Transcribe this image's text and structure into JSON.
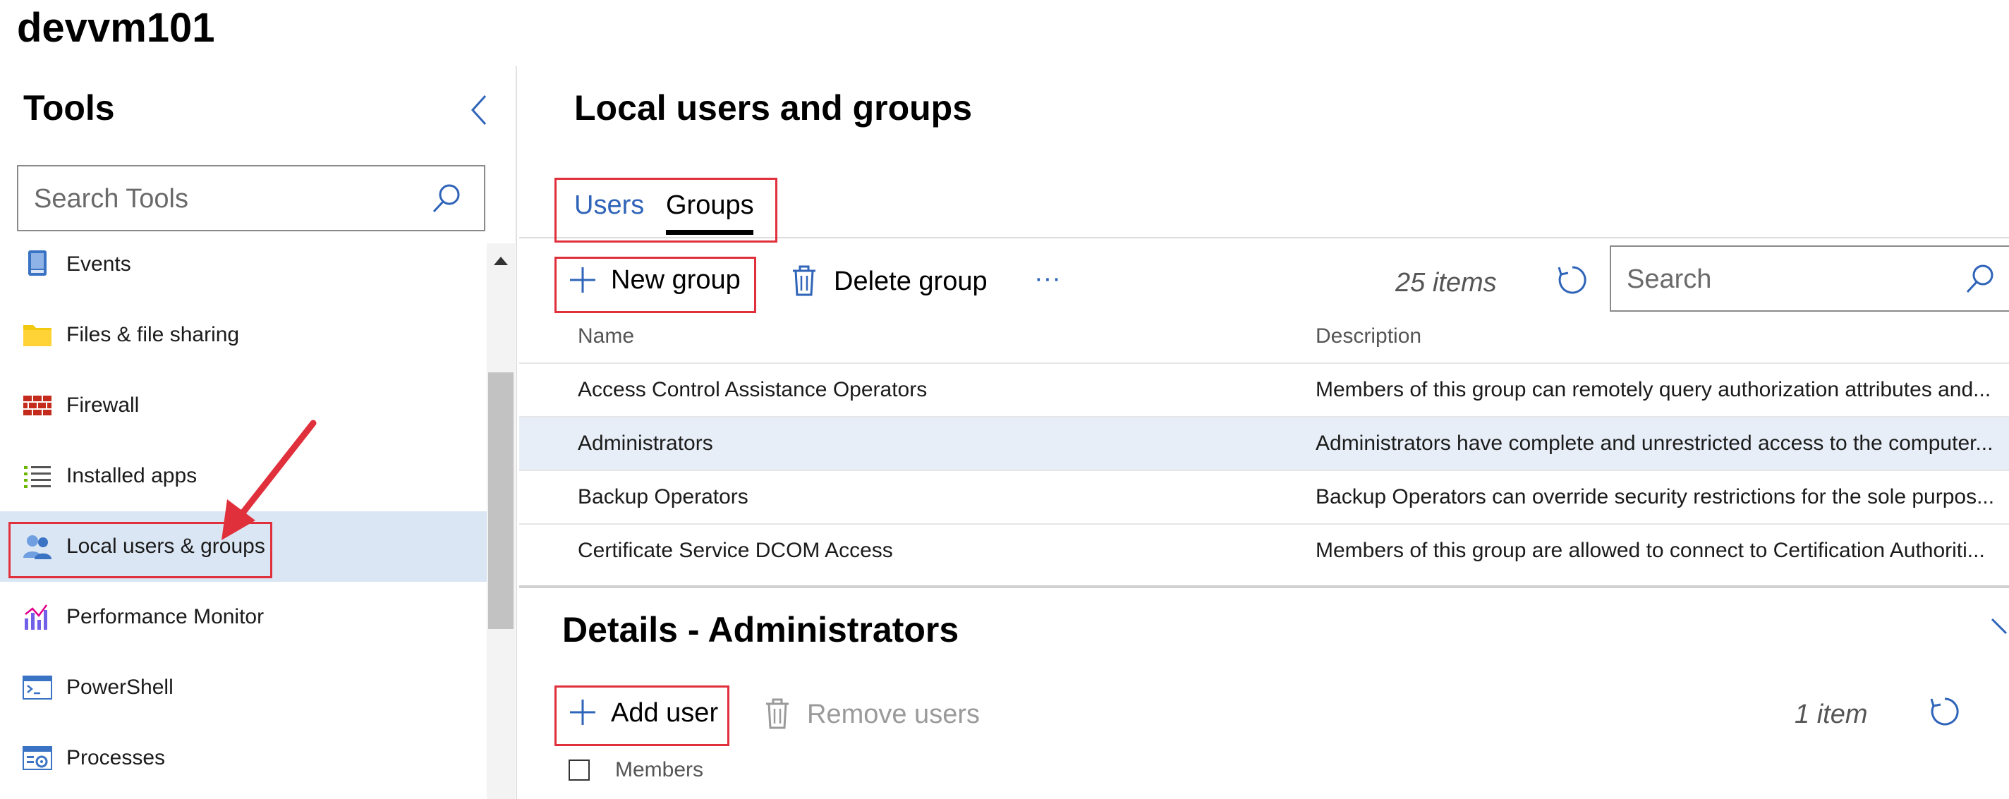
{
  "server_name": "devvm101",
  "colors": {
    "accent": "#2f64b8",
    "highlight": "#e0303c",
    "selected": "#dbe6f4"
  },
  "sidebar": {
    "title": "Tools",
    "search_placeholder": "Search Tools",
    "items": [
      {
        "label": "Events",
        "icon": "events-icon"
      },
      {
        "label": "Files & file sharing",
        "icon": "folder-icon"
      },
      {
        "label": "Firewall",
        "icon": "firewall-icon"
      },
      {
        "label": "Installed apps",
        "icon": "list-icon"
      },
      {
        "label": "Local users & groups",
        "icon": "users-icon",
        "selected": true
      },
      {
        "label": "Performance Monitor",
        "icon": "chart-icon"
      },
      {
        "label": "PowerShell",
        "icon": "powershell-icon"
      },
      {
        "label": "Processes",
        "icon": "processes-icon"
      }
    ]
  },
  "main": {
    "title": "Local users and groups",
    "tabs": [
      {
        "label": "Users"
      },
      {
        "label": "Groups",
        "active": true
      }
    ],
    "toolbar": {
      "new_group": "New group",
      "delete_group": "Delete group",
      "more": "···",
      "count": "25 items",
      "search_placeholder": "Search"
    },
    "columns": [
      "Name",
      "Description"
    ],
    "rows": [
      {
        "name": "Access Control Assistance Operators",
        "description": "Members of this group can remotely query authorization attributes and..."
      },
      {
        "name": "Administrators",
        "description": "Administrators have complete and unrestricted access to the computer...",
        "selected": true
      },
      {
        "name": "Backup Operators",
        "description": "Backup Operators can override security restrictions for the sole purpos..."
      },
      {
        "name": "Certificate Service DCOM Access",
        "description": "Members of this group are allowed to connect to Certification Authoriti..."
      }
    ]
  },
  "details": {
    "title": "Details - Administrators",
    "add_user": "Add user",
    "remove_users": "Remove users",
    "count": "1 item",
    "members_header": "Members"
  }
}
